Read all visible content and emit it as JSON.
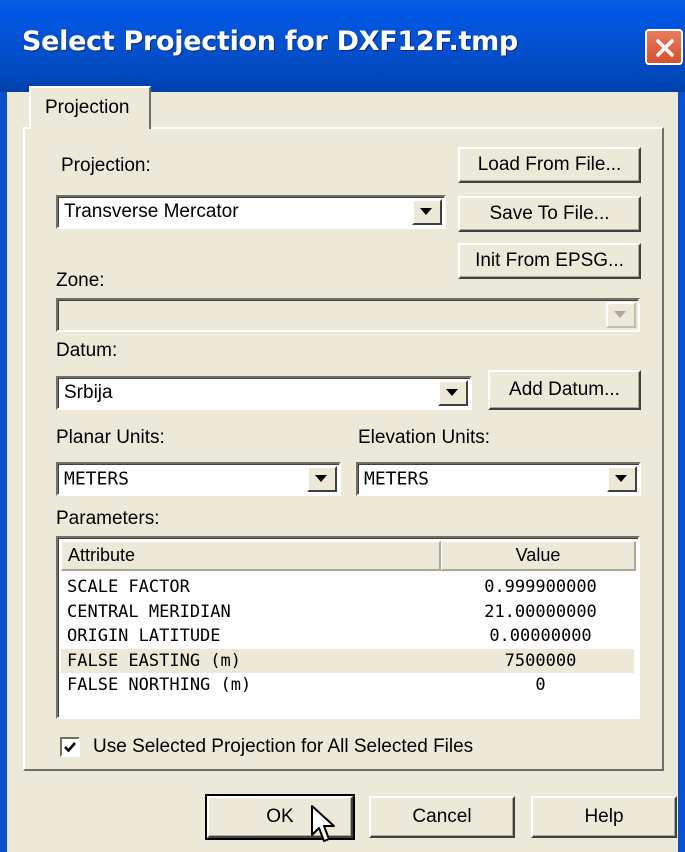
{
  "window": {
    "title": "Select Projection for DXF12F.tmp"
  },
  "tabs": [
    {
      "label": "Projection"
    }
  ],
  "projection": {
    "label": "Projection:",
    "value": "Transverse Mercator",
    "load_button": "Load From File...",
    "save_button": "Save To File...",
    "init_button": "Init From EPSG..."
  },
  "zone": {
    "label": "Zone:",
    "value": ""
  },
  "datum": {
    "label": "Datum:",
    "value": "Srbija",
    "add_button": "Add Datum..."
  },
  "planar_units": {
    "label": "Planar Units:",
    "value": "METERS"
  },
  "elevation_units": {
    "label": "Elevation Units:",
    "value": "METERS"
  },
  "parameters": {
    "label": "Parameters:",
    "columns": [
      "Attribute",
      "Value"
    ],
    "rows": [
      {
        "attribute": "SCALE FACTOR",
        "value": "0.999900000"
      },
      {
        "attribute": "CENTRAL MERIDIAN",
        "value": "21.00000000"
      },
      {
        "attribute": "ORIGIN LATITUDE",
        "value": "0.00000000"
      },
      {
        "attribute": "FALSE EASTING (m)",
        "value": "7500000"
      },
      {
        "attribute": "FALSE NORTHING (m)",
        "value": "0"
      }
    ]
  },
  "use_selected": {
    "label": "Use Selected Projection for All Selected Files",
    "checked": true
  },
  "footer": {
    "ok": "OK",
    "cancel": "Cancel",
    "help": "Help"
  },
  "colors": {
    "titlebar": "#0350d0",
    "face": "#ece9d8",
    "close": "#d7502d"
  }
}
